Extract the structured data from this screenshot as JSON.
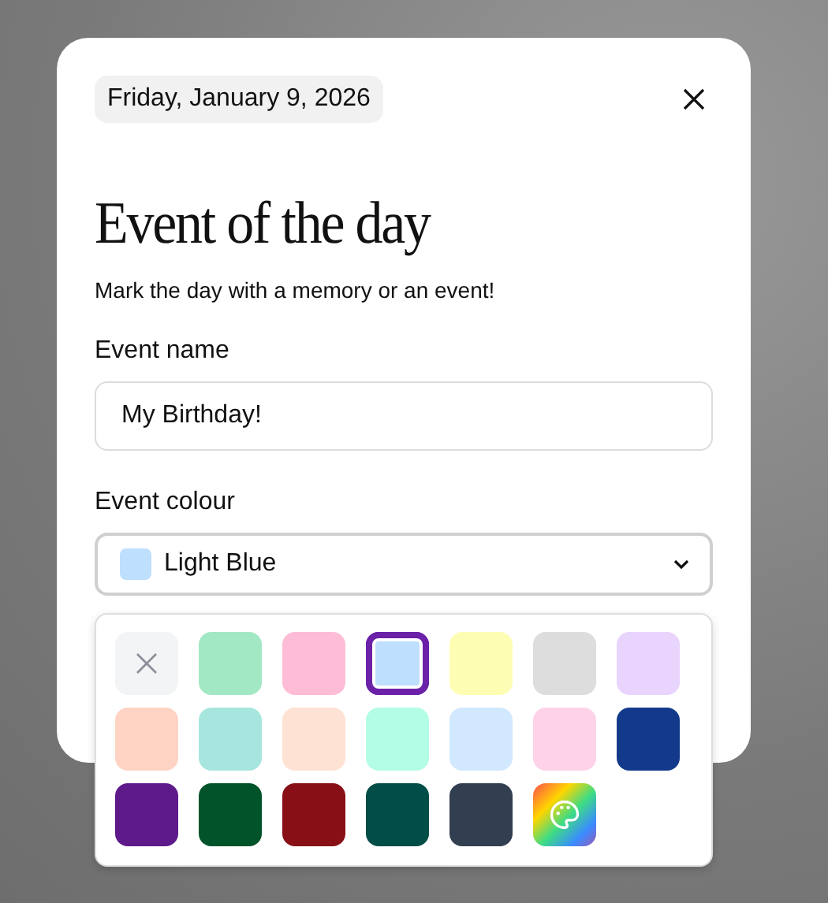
{
  "dialog": {
    "date": "Friday, January 9, 2026",
    "title": "Event of the day",
    "subtitle": "Mark the day with a memory or an event!"
  },
  "event_name": {
    "label": "Event name",
    "value": "My Birthday!"
  },
  "event_colour": {
    "label": "Event colour",
    "value": "Light Blue",
    "color": "#bfdffe",
    "expanded": true
  },
  "swatches": [
    {
      "kind": "none",
      "selected": false
    },
    {
      "kind": "color",
      "color": "#a3e8c4",
      "selected": false
    },
    {
      "kind": "color",
      "color": "#febcd7",
      "selected": false
    },
    {
      "kind": "color",
      "color": "#bfdffe",
      "selected": true
    },
    {
      "kind": "color",
      "color": "#fefdb4",
      "selected": false
    },
    {
      "kind": "color",
      "color": "#dddddd",
      "selected": false
    },
    {
      "kind": "color",
      "color": "#e9d4fd",
      "selected": false
    },
    {
      "kind": "color",
      "color": "#fed3c3",
      "selected": false
    },
    {
      "kind": "color",
      "color": "#a7e6df",
      "selected": false
    },
    {
      "kind": "color",
      "color": "#fee2d3",
      "selected": false
    },
    {
      "kind": "color",
      "color": "#b3fde6",
      "selected": false
    },
    {
      "kind": "color",
      "color": "#d1e8fe",
      "selected": false
    },
    {
      "kind": "color",
      "color": "#fed2e9",
      "selected": false
    },
    {
      "kind": "color",
      "color": "#133a8a",
      "selected": false
    },
    {
      "kind": "color",
      "color": "#5e198a",
      "selected": false
    },
    {
      "kind": "color",
      "color": "#01532a",
      "selected": false
    },
    {
      "kind": "color",
      "color": "#880f16",
      "selected": false
    },
    {
      "kind": "color",
      "color": "#014d48",
      "selected": false
    },
    {
      "kind": "color",
      "color": "#323f50",
      "selected": false
    },
    {
      "kind": "custom",
      "selected": false
    }
  ]
}
